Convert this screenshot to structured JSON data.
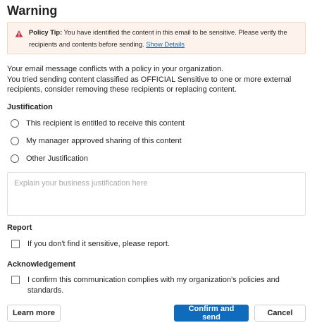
{
  "dialog": {
    "title": "Warning"
  },
  "policy_tip": {
    "label": "Policy Tip:",
    "text": " You have identified the content in this email to be sensitive. Please verify the recipients and contents before sending. ",
    "link": "Show Details",
    "icon": "warning-triangle-icon",
    "icon_color": "#c4314b"
  },
  "message": {
    "line1": "Your email message conflicts with a policy in your organization.",
    "line2": "You tried sending content classified as OFFICIAL Sensitive to one or more external recipients, consider removing these recipients or replacing content."
  },
  "justification": {
    "heading": "Justification",
    "options": [
      "This recipient is entitled to receive this content",
      "My manager approved sharing of this content",
      "Other Justification"
    ],
    "selected": null,
    "placeholder": "Explain your business justification here",
    "value": ""
  },
  "report": {
    "heading": "Report",
    "checkbox_label": "If you don't find it sensitive, please report.",
    "checked": false
  },
  "acknowledgement": {
    "heading": "Acknowledgement",
    "checkbox_label": "I confirm this communication complies with my organization's policies and standards.",
    "checked": false
  },
  "buttons": {
    "learn_more": "Learn more",
    "confirm": "Confirm and send",
    "cancel": "Cancel"
  },
  "colors": {
    "primary": "#0f6cbd",
    "tip_background": "#fdf3ec",
    "tip_border": "#f3d6c6"
  }
}
